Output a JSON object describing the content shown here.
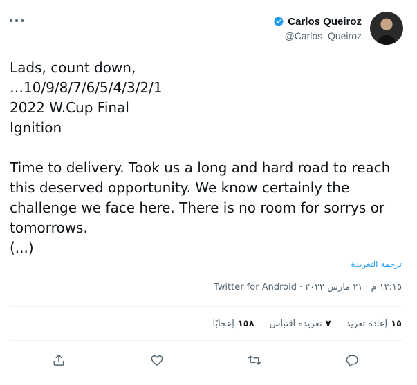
{
  "author": {
    "display_name": "Carlos Queiroz",
    "handle": "@Carlos_Queiroz",
    "verified": true
  },
  "tweet": {
    "lines": [
      "Lads, count down,",
      "…10/9/8/7/6/5/4/3/2/1",
      "2022 W.Cup Final",
      "Ignition",
      "Time to delivery. Took us a long and hard road to reach",
      "this deserved opportunity. We know certainly the",
      "challenge we face here. There is no room for sorrys or",
      "tomorrows.",
      "(...)"
    ]
  },
  "translate_label": "ترجمة التغريدة",
  "meta": {
    "time": "١٢:١٥ م",
    "date": "٢١ مارس ٢٠٢٢",
    "source": "Twitter for Android",
    "separator": "·"
  },
  "stats": {
    "retweets": {
      "count": "١٥",
      "label": "إعادة تغريد"
    },
    "quotes": {
      "count": "٧",
      "label": "تغريدة اقتباس"
    },
    "likes": {
      "count": "١٥٨",
      "label": "إعجابًا"
    }
  },
  "icons": {
    "more": "more-horizontal-icon",
    "verified": "verified-badge-icon",
    "reply": "reply-icon",
    "retweet": "retweet-icon",
    "like": "like-icon",
    "share": "share-icon"
  },
  "colors": {
    "accent": "#1d9bf0",
    "text_primary": "#0f1419",
    "text_secondary": "#536471",
    "divider": "#eff3f4"
  }
}
